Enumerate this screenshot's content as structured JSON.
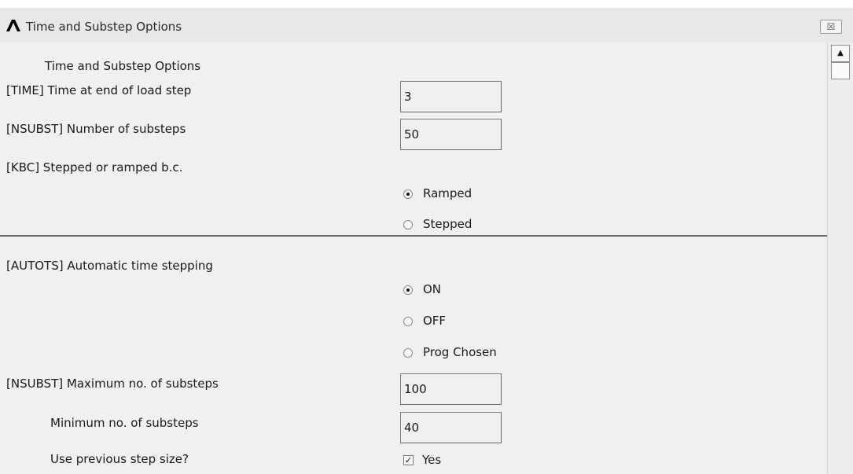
{
  "window": {
    "title": "Time and Substep Options",
    "close_glyph": "☒"
  },
  "section1": {
    "heading": "Time and Substep Options",
    "time": {
      "label": "[TIME]  Time at end of load step",
      "value": "3"
    },
    "nsubst": {
      "label": "[NSUBST]  Number of substeps",
      "value": "50"
    },
    "kbc": {
      "label": "[KBC]     Stepped or ramped b.c.",
      "options": [
        "Ramped",
        "Stepped"
      ],
      "selected": "Ramped"
    }
  },
  "section2": {
    "autots": {
      "label": "[AUTOTS] Automatic time stepping",
      "options": [
        "ON",
        "OFF",
        "Prog Chosen"
      ],
      "selected": "ON"
    },
    "max_substeps": {
      "label": "[NSUBST] Maximum no. of substeps",
      "value": "100"
    },
    "min_substeps": {
      "label": "Minimum no. of substeps",
      "value": "40"
    },
    "use_prev": {
      "label": "Use previous step size?",
      "checkbox_label": "Yes",
      "checked": true
    }
  },
  "scrollbar": {
    "up_arrow": "▲"
  }
}
